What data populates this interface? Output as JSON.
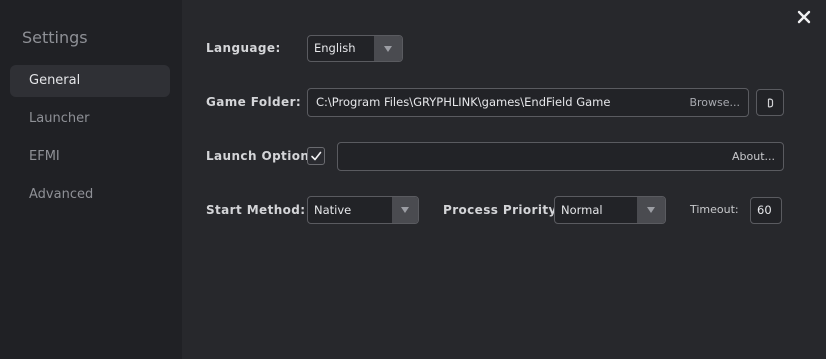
{
  "sidebar": {
    "title": "Settings",
    "items": [
      {
        "label": "General",
        "active": true
      },
      {
        "label": "Launcher",
        "active": false
      },
      {
        "label": "EFMI",
        "active": false
      },
      {
        "label": "Advanced",
        "active": false
      }
    ]
  },
  "general": {
    "language": {
      "label": "Language:",
      "value": "English"
    },
    "game_folder": {
      "label": "Game Folder:",
      "value": "C:\\Program Files\\GRYPHLINK\\games\\EndField Game",
      "browse_label": "Browse..."
    },
    "launch_options": {
      "label": "Launch Options:",
      "checked": true,
      "value": "",
      "about_label": "About..."
    },
    "start_method": {
      "label": "Start Method:",
      "value": "Native"
    },
    "process_priority": {
      "label": "Process Priority:",
      "value": "Normal"
    },
    "timeout": {
      "label": "Timeout:",
      "value": "60"
    }
  },
  "icons": {
    "close": "close-icon",
    "dropdown": "chevron-down-icon",
    "open_folder": "folder-open-icon",
    "check": "check-icon"
  },
  "colors": {
    "sidebar_bg": "#202125",
    "main_bg": "#27282c",
    "active_item_bg": "#2f3035",
    "field_border": "#5a5b60"
  }
}
